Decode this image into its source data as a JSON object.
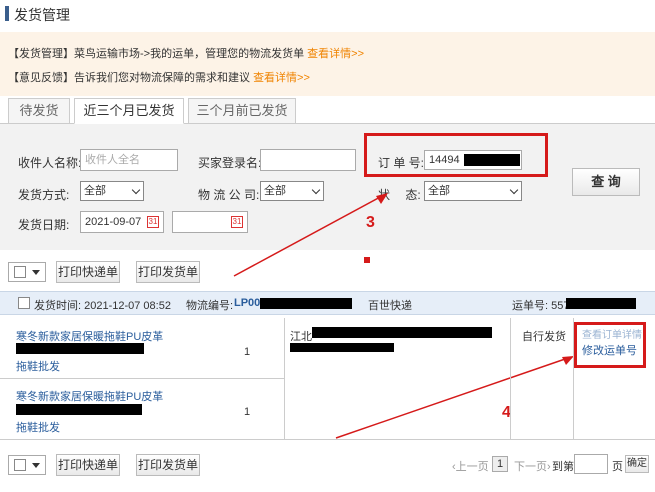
{
  "page_title": "发货管理",
  "notice": {
    "line1_tag": "【发货管理】",
    "line1_text": "菜鸟运输市场->我的运单，管理您的物流发货单",
    "line1_link": "查看详情>>",
    "line2_tag": "【意见反馈】",
    "line2_text": "告诉我们您对物流保障的需求和建议",
    "line2_link": "查看详情>>"
  },
  "tabs": [
    "待发货",
    "近三个月已发货",
    "三个月前已发货"
  ],
  "search": {
    "receiver_label": "收件人名称:",
    "receiver_placeholder": "收件人全名",
    "buyer_label": "买家登录名:",
    "order_label": "订 单 号:",
    "order_value": "14494",
    "ship_method_label": "发货方式:",
    "ship_method_value": "全部",
    "logistics_label": "物 流 公 司:",
    "logistics_value": "全部",
    "status_label": "状　 态:",
    "status_value": "全部",
    "ship_date_label": "发货日期:",
    "ship_date_value": "2021-09-07",
    "search_button": "查 询"
  },
  "toolbar": {
    "print_express": "打印快递单",
    "print_invoice": "打印发货单"
  },
  "order": {
    "ship_time": "发货时间: 2021-12-07 08:52",
    "logistics_no_label": "物流编号:",
    "logistics_no": "LP00",
    "carrier": "百世快递",
    "waybill_label": "运单号: 557",
    "items": [
      {
        "title": "寒冬新款家居保暖拖鞋PU皮革",
        "suffix": "拖鞋批发",
        "qty": "1"
      },
      {
        "title": "寒冬新款家居保暖拖鞋PU皮革",
        "suffix": "拖鞋批发",
        "qty": "1"
      }
    ],
    "address": "江北",
    "ship_mode": "自行发货",
    "detail_link": "查看订单详情",
    "modify_link": "修改运单号"
  },
  "pager": {
    "prev": "上一页",
    "page": "1",
    "next": "下一页",
    "goto": "到第",
    "page_unit": "页",
    "confirm": "确定"
  },
  "annotations": [
    "3",
    "4"
  ],
  "colors": {
    "accent_red": "#d51a1a",
    "link_orange": "#f08300",
    "link_blue": "#2a5d9c"
  }
}
